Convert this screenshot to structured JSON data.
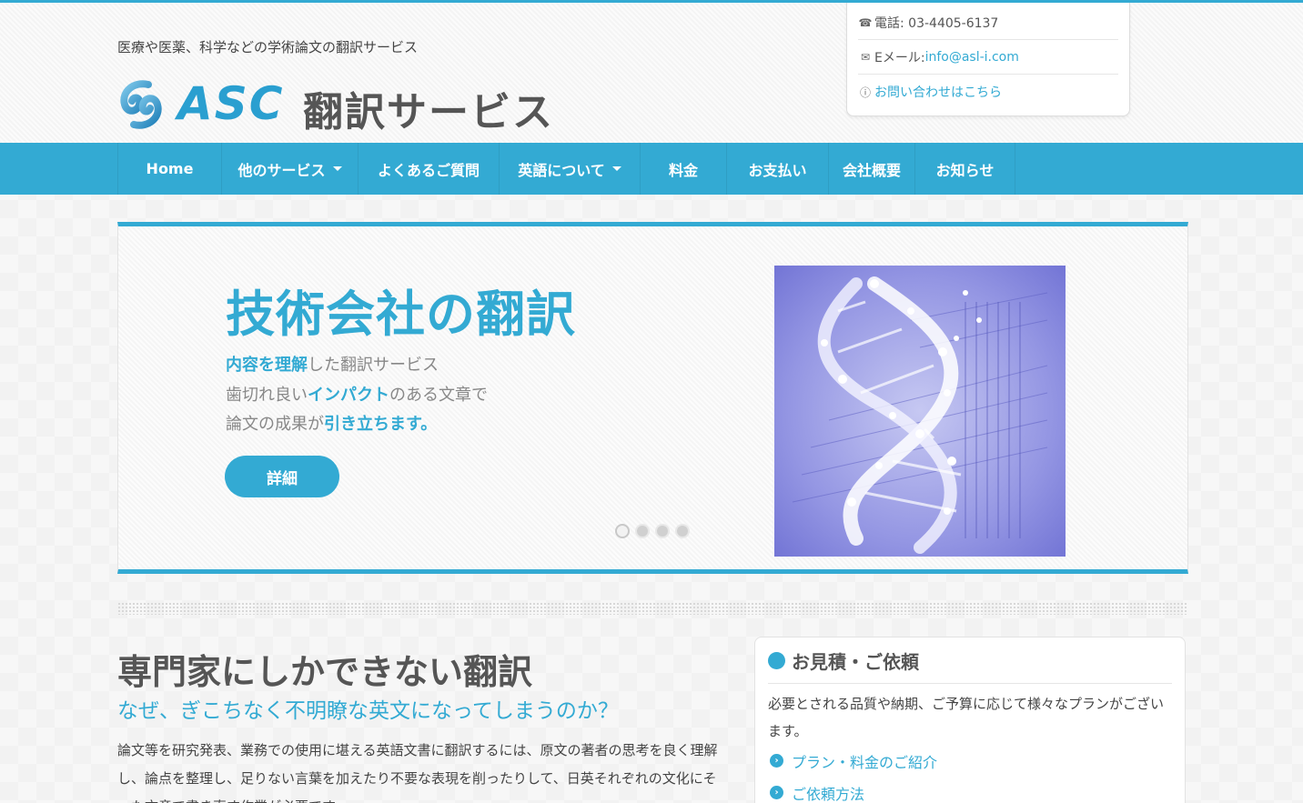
{
  "header": {
    "tagline": "医療や医薬、科学などの学術論文の翻訳サービス",
    "logo_letters": "ASC",
    "logo_text": "翻訳サービス"
  },
  "contact": {
    "phone_label": "電話: 03-4405-6137",
    "email_label": "Eメール: ",
    "email_value": "info@asl-i.com",
    "inquiry_label": "お問い合わせはこちら"
  },
  "nav": {
    "items": [
      {
        "label": "Home",
        "dropdown": false
      },
      {
        "label": "他のサービス",
        "dropdown": true
      },
      {
        "label": "よくあるご質問",
        "dropdown": false
      },
      {
        "label": "英語について",
        "dropdown": true
      },
      {
        "label": "料金",
        "dropdown": false
      },
      {
        "label": "お支払い",
        "dropdown": false
      },
      {
        "label": "会社概要",
        "dropdown": false
      },
      {
        "label": "お知らせ",
        "dropdown": false
      }
    ]
  },
  "slider": {
    "title": "技術会社の翻訳",
    "line1_highlight": "内容を理解",
    "line1_rest": "した翻訳サービス",
    "line2_prefix": "歯切れ良い",
    "line2_highlight": "インパクト",
    "line2_rest": "のある文章で",
    "line3_prefix": "論文の成果が",
    "line3_highlight": "引き立ちます。",
    "button_label": "詳細",
    "slide_count": 4,
    "active_slide": 1
  },
  "main": {
    "heading": "専門家にしかできない翻訳",
    "subheading": "なぜ、ぎこちなく不明瞭な英文になってしまうのか？",
    "body": "論文等を研究発表、業務での使用に堪える英語文書に翻訳するには、原文の著者の思考を良く理解し、論点を整理し、足りない言葉を加えたり不要な表現を削ったりして、日英それぞれの文化にそった文章で書き直す作業が必要です。"
  },
  "sidebar": {
    "title": "お見積・ご依頼",
    "text": "必要とされる品質や納期、ご予算に応じて様々なプランがございます。",
    "links": [
      {
        "label": "プラン・料金のご紹介"
      },
      {
        "label": "ご依頼方法"
      }
    ]
  },
  "colors": {
    "accent": "#33aad3",
    "heading": "#555555",
    "text": "#444444"
  },
  "icons": [
    "phone-icon",
    "envelope-icon",
    "info-icon",
    "chevron-right-icon",
    "caret-down-icon"
  ]
}
